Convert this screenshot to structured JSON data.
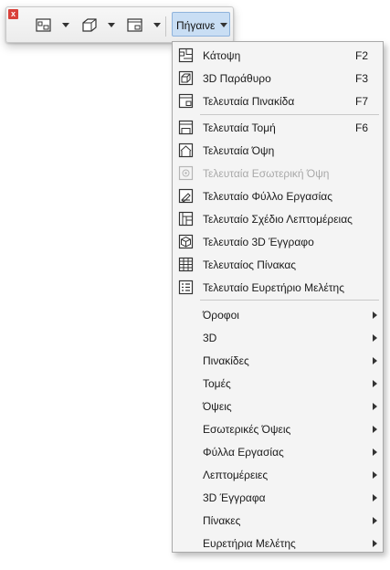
{
  "toolbar": {
    "close_glyph": "x",
    "buttons": [
      {
        "icon": "floor-plan-view-icon"
      },
      {
        "icon": "3d-window-icon"
      },
      {
        "icon": "layout-icon"
      }
    ],
    "goto_label": "Πήγαινε"
  },
  "menu": {
    "items": [
      {
        "label": "Κάτοψη",
        "shortcut": "F2",
        "icon": "floor-plan-icon"
      },
      {
        "label": "3D Παράθυρο",
        "shortcut": "F3",
        "icon": "3d-window-icon"
      },
      {
        "label": "Τελευταία Πινακίδα",
        "shortcut": "F7",
        "icon": "layout-icon"
      },
      {
        "label": "Τελευταία Τομή",
        "shortcut": "F6",
        "icon": "section-icon"
      },
      {
        "label": "Τελευταία Όψη",
        "shortcut": "",
        "icon": "elevation-icon"
      },
      {
        "label": "Τελευταία Εσωτερική Όψη",
        "shortcut": "",
        "icon": "interior-elevation-icon",
        "disabled": true
      },
      {
        "label": "Τελευταίο Φύλλο Εργασίας",
        "shortcut": "",
        "icon": "worksheet-icon"
      },
      {
        "label": "Τελευταίο Σχέδιο Λεπτομέρειας",
        "shortcut": "",
        "icon": "detail-icon"
      },
      {
        "label": "Τελευταίο 3D Έγγραφο",
        "shortcut": "",
        "icon": "3d-document-icon"
      },
      {
        "label": "Τελευταίος Πίνακας",
        "shortcut": "",
        "icon": "schedule-icon"
      },
      {
        "label": "Τελευταίο Ευρετήριο Μελέτης",
        "shortcut": "",
        "icon": "project-index-icon"
      }
    ],
    "submenus": [
      {
        "label": "Όροφοι"
      },
      {
        "label": "3D"
      },
      {
        "label": "Πινακίδες"
      },
      {
        "label": "Τομές"
      },
      {
        "label": "Όψεις"
      },
      {
        "label": "Εσωτερικές Όψεις"
      },
      {
        "label": "Φύλλα Εργασίας"
      },
      {
        "label": "Λεπτομέρειες"
      },
      {
        "label": "3D Έγγραφα"
      },
      {
        "label": "Πίνακες"
      },
      {
        "label": "Ευρετήρια Μελέτης"
      }
    ]
  }
}
